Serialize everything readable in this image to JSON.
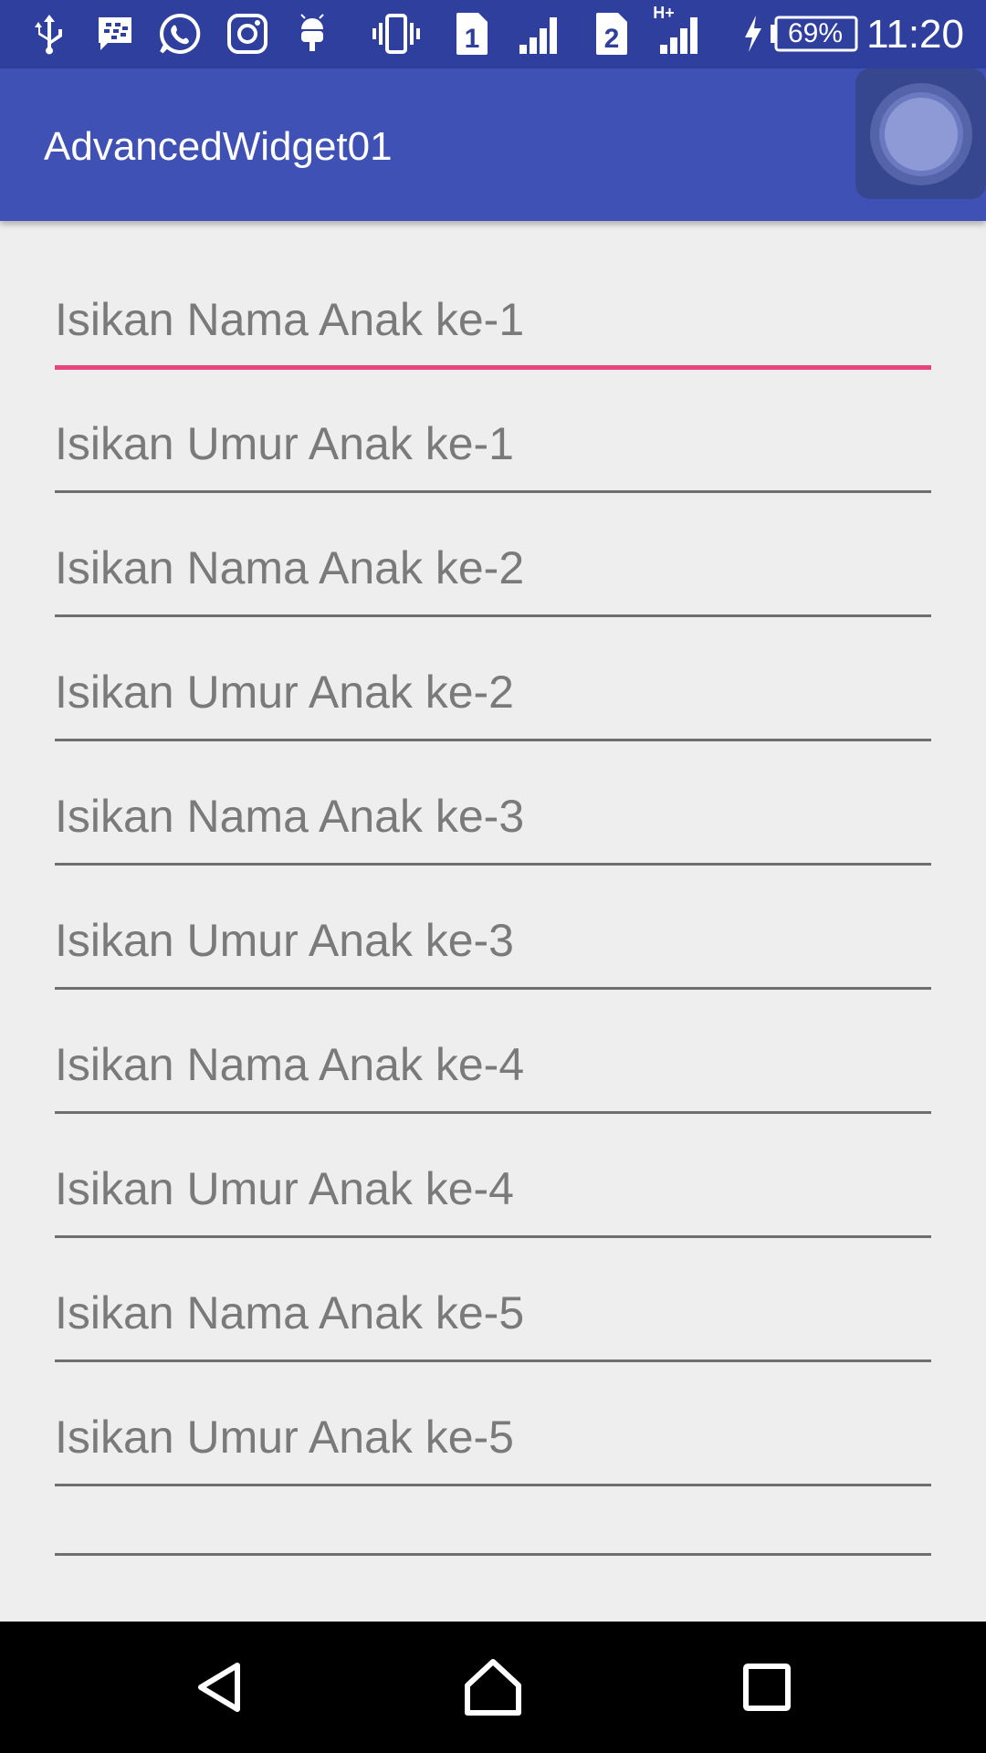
{
  "status_bar": {
    "battery_text": "69%",
    "sim1_label": "1",
    "sim2_label": "2",
    "network_type": "H+",
    "time": "11:20",
    "icons": [
      "usb-icon",
      "bbm-icon",
      "whatsapp-icon",
      "instagram-icon",
      "android-debug-icon",
      "vibrate-icon",
      "sim1-icon",
      "signal1-icon",
      "sim2-icon",
      "signal2-icon",
      "charging-icon",
      "battery-icon"
    ]
  },
  "app_bar": {
    "title": "AdvancedWidget01",
    "overlay_button_icon": "assistive-touch-icon"
  },
  "form": {
    "fields": [
      {
        "placeholder": "Isikan Nama Anak ke-1",
        "value": "",
        "focused": true
      },
      {
        "placeholder": "Isikan Umur Anak ke-1",
        "value": ""
      },
      {
        "placeholder": "Isikan Nama Anak ke-2",
        "value": ""
      },
      {
        "placeholder": "Isikan Umur Anak ke-2",
        "value": ""
      },
      {
        "placeholder": "Isikan Nama Anak ke-3",
        "value": ""
      },
      {
        "placeholder": "Isikan Umur Anak ke-3",
        "value": ""
      },
      {
        "placeholder": "Isikan Nama Anak ke-4",
        "value": ""
      },
      {
        "placeholder": "Isikan Umur Anak ke-4",
        "value": ""
      },
      {
        "placeholder": "Isikan Nama Anak ke-5",
        "value": ""
      },
      {
        "placeholder": "Isikan Umur Anak ke-5",
        "value": ""
      },
      {
        "placeholder": "",
        "value": ""
      }
    ]
  },
  "nav_bar": {
    "icons": [
      "back-icon",
      "home-icon",
      "recents-icon"
    ]
  },
  "colors": {
    "status_bar": "#2f3f9e",
    "app_bar": "#3f51b5",
    "accent": "#e8457e",
    "background": "#eeeeee",
    "underline": "#6f6f6f"
  }
}
